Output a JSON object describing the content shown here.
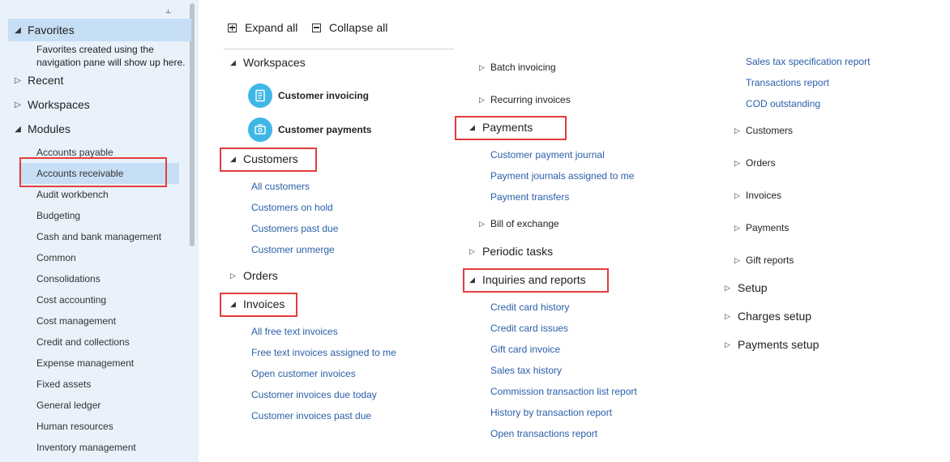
{
  "nav": {
    "favorites": "Favorites",
    "favorites_note_line1": "Favorites created using the",
    "favorites_note_line2": "navigation pane will show up here.",
    "recent": "Recent",
    "workspaces": "Workspaces",
    "modules": "Modules",
    "modules_list": [
      "Accounts payable",
      "Accounts receivable",
      "Audit workbench",
      "Budgeting",
      "Cash and bank management",
      "Common",
      "Consolidations",
      "Cost accounting",
      "Cost management",
      "Credit and collections",
      "Expense management",
      "Fixed assets",
      "General ledger",
      "Human resources",
      "Inventory management"
    ]
  },
  "toolbar": {
    "expand_all": "Expand all",
    "collapse_all": "Collapse all"
  },
  "col1": {
    "workspaces": "Workspaces",
    "ws_invoicing": "Customer invoicing",
    "ws_payments": "Customer payments",
    "customers": "Customers",
    "customers_links": [
      "All customers",
      "Customers on hold",
      "Customers past due",
      "Customer unmerge"
    ],
    "orders": "Orders",
    "invoices": "Invoices",
    "invoices_links": [
      "All free text invoices",
      "Free text invoices assigned to me",
      "Open customer invoices",
      "Customer invoices due today",
      "Customer invoices past due"
    ]
  },
  "col2": {
    "batch_invoicing": "Batch invoicing",
    "recurring_invoices": "Recurring invoices",
    "payments": "Payments",
    "payments_links": [
      "Customer payment journal",
      "Payment journals assigned to me",
      "Payment transfers"
    ],
    "bill_of_exchange": "Bill of exchange",
    "periodic_tasks": "Periodic tasks",
    "inquiries": "Inquiries and reports",
    "inquiries_links": [
      "Credit card history",
      "Credit card issues",
      "Gift card invoice",
      "Sales tax history",
      "Commission transaction list report",
      "History by transaction report",
      "Open transactions report"
    ]
  },
  "col3": {
    "links": [
      "Sales tax specification report",
      "Transactions report",
      "COD outstanding"
    ],
    "subs": [
      "Customers",
      "Orders",
      "Invoices",
      "Payments",
      "Gift reports"
    ],
    "setup": "Setup",
    "charges_setup": "Charges setup",
    "payments_setup": "Payments setup"
  },
  "colors": {
    "link": "#2a5fa8",
    "nav_bg": "#e9f2fb",
    "selected": "#c7dff5",
    "highlight": "#e53d3d",
    "tile": "#3fb7e6"
  }
}
